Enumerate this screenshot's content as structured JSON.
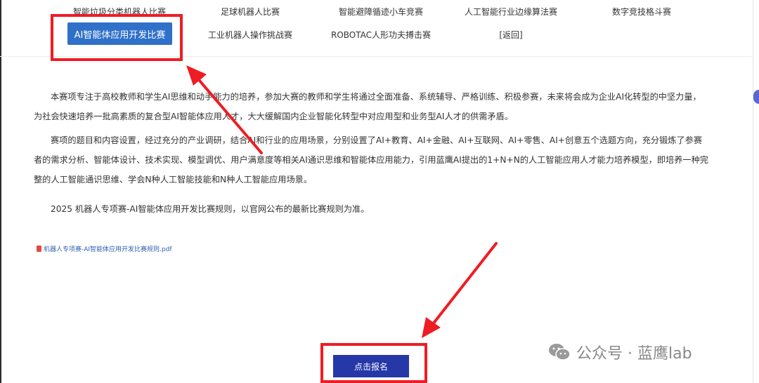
{
  "nav": {
    "row1": [
      "智能垃圾分类机器人比赛",
      "足球机器人比赛",
      "智能避障循迹小车竞赛",
      "人工智能行业边缘算法赛",
      "数字竞技格斗赛"
    ],
    "row2": [
      "AI智能体应用开发比赛",
      "工业机器人操作挑战赛",
      "ROBOTAC人形功夫搏击赛",
      "[返回]"
    ]
  },
  "content": {
    "p1": "本赛项专注于高校教师和学生AI思维和动手能力的培养，参加大赛的教师和学生将通过全面准备、系统辅导、严格训练、积极参赛，未来将会成为企业AI化转型的中坚力量，为社会快速培养一批高素质的复合型AI智能体应用人才，大大缓解国内企业智能化转型中对应用型和业务型AI人才的供需矛盾。",
    "p2": "赛项的题目和内容设置，经过充分的产业调研，结合AI和行业的应用场景，分别设置了AI+教育、AI+金融、AI+互联网、AI+零售、AI+创意五个选题方向，充分锻炼了参赛者的需求分析、智能体设计、技术实现、模型调优、用户满意度等相关AI通识思维和智能体应用能力，引用蓝鹰AI提出的1+N+N的人工智能应用人才能力培养模型，即培养一种完整的人工智能通识思维、学会N种人工智能技能和N种人工智能应用场景。",
    "p3": "2025 机器人专项赛-AI智能体应用开发比赛规则，以官网公布的最新比赛规则为准。"
  },
  "attachment": {
    "label": "机器人专项赛-AI智能体应用开发比赛规则.pdf"
  },
  "signup": {
    "label": "点击报名"
  },
  "watermark": {
    "text": "公众号 · 蓝鹰lab"
  },
  "colors": {
    "accent": "#2f70c9",
    "button": "#2637a8",
    "highlight": "#ee1d23",
    "link": "#2f5fb3"
  }
}
